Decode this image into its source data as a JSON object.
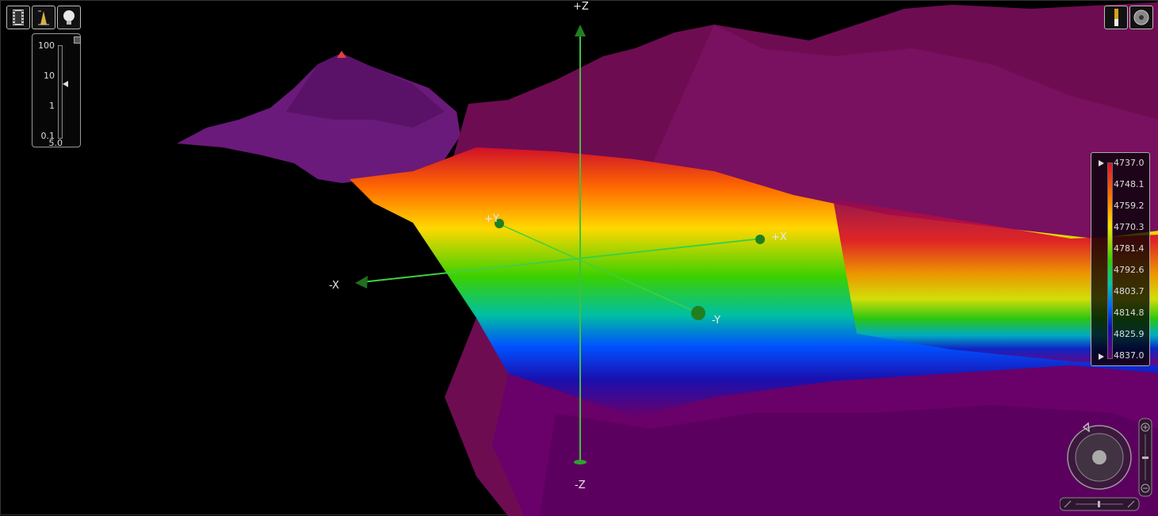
{
  "axes": {
    "pos_z": "+Z",
    "neg_z": "-Z",
    "pos_x": "+X",
    "neg_x": "-X",
    "pos_y": "+Y",
    "neg_y": "-Y"
  },
  "toolbar_left": {
    "icons": [
      "film-icon",
      "height-profile-icon",
      "lightbulb-icon"
    ]
  },
  "toolbar_right": {
    "icons": [
      "vertical-bar-icon",
      "disc-icon"
    ]
  },
  "zoom_panel": {
    "labels": [
      "100",
      "10",
      "1",
      "0.1"
    ],
    "value": "5.0"
  },
  "legend": {
    "values": [
      "4737.0",
      "4748.1",
      "4759.2",
      "4770.3",
      "4781.4",
      "4792.6",
      "4803.7",
      "4814.8",
      "4825.9",
      "4837.0"
    ],
    "colors": [
      "#e0102a",
      "#ff7a00",
      "#ffe000",
      "#2fd000",
      "#00c8a0",
      "#0060ff",
      "#1010b0",
      "#6a006a"
    ]
  }
}
